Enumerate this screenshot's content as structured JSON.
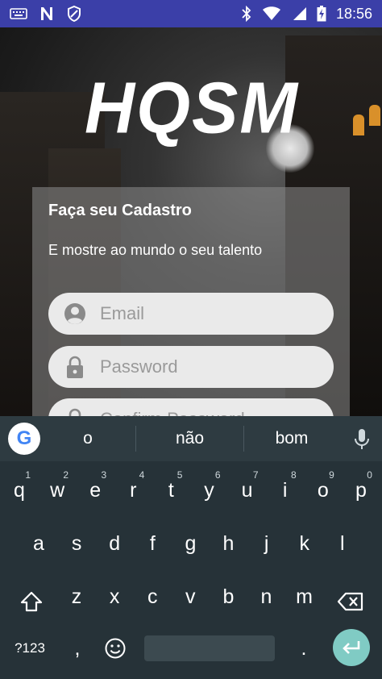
{
  "status_bar": {
    "time": "18:56",
    "icons_left": [
      "keyboard-icon",
      "n-notification-icon",
      "blocked-icon"
    ],
    "icons_right": [
      "bluetooth-icon",
      "wifi-icon",
      "signal-icon",
      "battery-charging-icon"
    ]
  },
  "header": {
    "logo_text": "HQSM"
  },
  "form": {
    "title": "Faça seu Cadastro",
    "subtitle": "E mostre ao mundo o seu talento",
    "email": {
      "placeholder": "Email",
      "icon": "person-icon"
    },
    "password": {
      "placeholder": "Password",
      "icon": "lock-icon"
    },
    "confirm_password": {
      "placeholder": "Confirm Password",
      "icon": "lock-icon"
    }
  },
  "keyboard": {
    "suggestions": [
      "o",
      "não",
      "bom"
    ],
    "row1": [
      {
        "k": "q",
        "h": "1"
      },
      {
        "k": "w",
        "h": "2"
      },
      {
        "k": "e",
        "h": "3"
      },
      {
        "k": "r",
        "h": "4"
      },
      {
        "k": "t",
        "h": "5"
      },
      {
        "k": "y",
        "h": "6"
      },
      {
        "k": "u",
        "h": "7"
      },
      {
        "k": "i",
        "h": "8"
      },
      {
        "k": "o",
        "h": "9"
      },
      {
        "k": "p",
        "h": "0"
      }
    ],
    "row2": [
      "a",
      "s",
      "d",
      "f",
      "g",
      "h",
      "j",
      "k",
      "l"
    ],
    "row3": [
      "z",
      "x",
      "c",
      "v",
      "b",
      "n",
      "m"
    ],
    "symbols_label": "?123",
    "comma": ",",
    "period": "."
  },
  "colors": {
    "status_bar": "#3b3fa8",
    "keyboard_bg": "#263238",
    "enter_key": "#80cbc4",
    "field_bg": "#eaeaea"
  }
}
